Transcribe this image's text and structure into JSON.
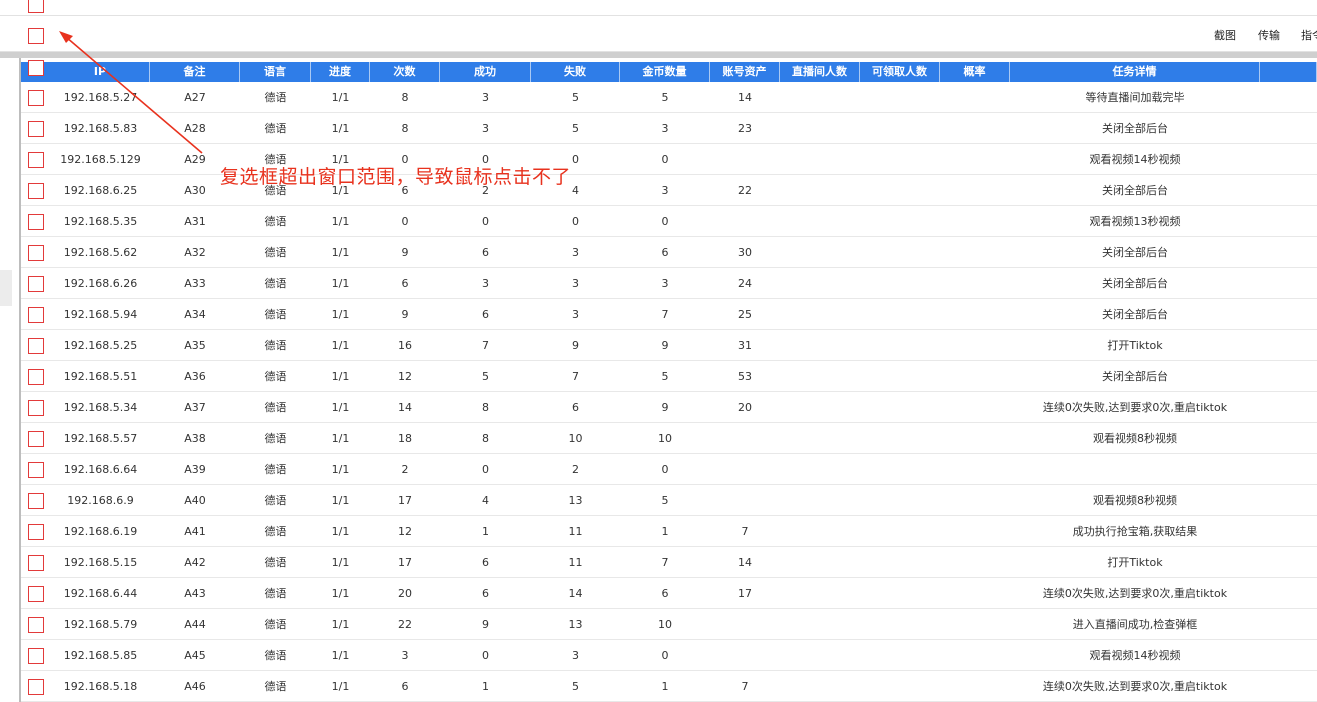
{
  "toolbar": {
    "screenshot_label": "截图",
    "transfer_label": "传输",
    "command_label": "指令"
  },
  "annotation": {
    "text": "复选框超出窗口范围，导致鼠标点击不了"
  },
  "table": {
    "header_color": "#2f7de8",
    "checkbox_color": "#e23a3a",
    "columns": [
      "IP",
      "备注",
      "语言",
      "进度",
      "次数",
      "成功",
      "失败",
      "金币数量",
      "账号资产",
      "直播间人数",
      "可领取人数",
      "概率",
      "任务详情"
    ],
    "rows": [
      {
        "ip": "192.168.5.27",
        "note": "A27",
        "lang": "德语",
        "progress": "1/1",
        "count": "8",
        "success": "3",
        "fail": "5",
        "coins": "5",
        "assets": "14",
        "live": "",
        "claim": "",
        "prob": "",
        "detail": "等待直播间加载完毕"
      },
      {
        "ip": "192.168.5.83",
        "note": "A28",
        "lang": "德语",
        "progress": "1/1",
        "count": "8",
        "success": "3",
        "fail": "5",
        "coins": "3",
        "assets": "23",
        "live": "",
        "claim": "",
        "prob": "",
        "detail": "关闭全部后台"
      },
      {
        "ip": "192.168.5.129",
        "note": "A29",
        "lang": "德语",
        "progress": "1/1",
        "count": "0",
        "success": "0",
        "fail": "0",
        "coins": "0",
        "assets": "",
        "live": "",
        "claim": "",
        "prob": "",
        "detail": "观看视频14秒视频"
      },
      {
        "ip": "192.168.6.25",
        "note": "A30",
        "lang": "德语",
        "progress": "1/1",
        "count": "6",
        "success": "2",
        "fail": "4",
        "coins": "3",
        "assets": "22",
        "live": "",
        "claim": "",
        "prob": "",
        "detail": "关闭全部后台"
      },
      {
        "ip": "192.168.5.35",
        "note": "A31",
        "lang": "德语",
        "progress": "1/1",
        "count": "0",
        "success": "0",
        "fail": "0",
        "coins": "0",
        "assets": "",
        "live": "",
        "claim": "",
        "prob": "",
        "detail": "观看视频13秒视频"
      },
      {
        "ip": "192.168.5.62",
        "note": "A32",
        "lang": "德语",
        "progress": "1/1",
        "count": "9",
        "success": "6",
        "fail": "3",
        "coins": "6",
        "assets": "30",
        "live": "",
        "claim": "",
        "prob": "",
        "detail": "关闭全部后台"
      },
      {
        "ip": "192.168.6.26",
        "note": "A33",
        "lang": "德语",
        "progress": "1/1",
        "count": "6",
        "success": "3",
        "fail": "3",
        "coins": "3",
        "assets": "24",
        "live": "",
        "claim": "",
        "prob": "",
        "detail": "关闭全部后台"
      },
      {
        "ip": "192.168.5.94",
        "note": "A34",
        "lang": "德语",
        "progress": "1/1",
        "count": "9",
        "success": "6",
        "fail": "3",
        "coins": "7",
        "assets": "25",
        "live": "",
        "claim": "",
        "prob": "",
        "detail": "关闭全部后台"
      },
      {
        "ip": "192.168.5.25",
        "note": "A35",
        "lang": "德语",
        "progress": "1/1",
        "count": "16",
        "success": "7",
        "fail": "9",
        "coins": "9",
        "assets": "31",
        "live": "",
        "claim": "",
        "prob": "",
        "detail": "打开Tiktok"
      },
      {
        "ip": "192.168.5.51",
        "note": "A36",
        "lang": "德语",
        "progress": "1/1",
        "count": "12",
        "success": "5",
        "fail": "7",
        "coins": "5",
        "assets": "53",
        "live": "",
        "claim": "",
        "prob": "",
        "detail": "关闭全部后台"
      },
      {
        "ip": "192.168.5.34",
        "note": "A37",
        "lang": "德语",
        "progress": "1/1",
        "count": "14",
        "success": "8",
        "fail": "6",
        "coins": "9",
        "assets": "20",
        "live": "",
        "claim": "",
        "prob": "",
        "detail": "连续0次失败,达到要求0次,重启tiktok"
      },
      {
        "ip": "192.168.5.57",
        "note": "A38",
        "lang": "德语",
        "progress": "1/1",
        "count": "18",
        "success": "8",
        "fail": "10",
        "coins": "10",
        "assets": "",
        "live": "",
        "claim": "",
        "prob": "",
        "detail": "观看视频8秒视频"
      },
      {
        "ip": "192.168.6.64",
        "note": "A39",
        "lang": "德语",
        "progress": "1/1",
        "count": "2",
        "success": "0",
        "fail": "2",
        "coins": "0",
        "assets": "",
        "live": "",
        "claim": "",
        "prob": "",
        "detail": ""
      },
      {
        "ip": "192.168.6.9",
        "note": "A40",
        "lang": "德语",
        "progress": "1/1",
        "count": "17",
        "success": "4",
        "fail": "13",
        "coins": "5",
        "assets": "",
        "live": "",
        "claim": "",
        "prob": "",
        "detail": "观看视频8秒视频"
      },
      {
        "ip": "192.168.6.19",
        "note": "A41",
        "lang": "德语",
        "progress": "1/1",
        "count": "12",
        "success": "1",
        "fail": "11",
        "coins": "1",
        "assets": "7",
        "live": "",
        "claim": "",
        "prob": "",
        "detail": "成功执行抢宝箱,获取结果"
      },
      {
        "ip": "192.168.5.15",
        "note": "A42",
        "lang": "德语",
        "progress": "1/1",
        "count": "17",
        "success": "6",
        "fail": "11",
        "coins": "7",
        "assets": "14",
        "live": "",
        "claim": "",
        "prob": "",
        "detail": "打开Tiktok"
      },
      {
        "ip": "192.168.6.44",
        "note": "A43",
        "lang": "德语",
        "progress": "1/1",
        "count": "20",
        "success": "6",
        "fail": "14",
        "coins": "6",
        "assets": "17",
        "live": "",
        "claim": "",
        "prob": "",
        "detail": "连续0次失败,达到要求0次,重启tiktok"
      },
      {
        "ip": "192.168.5.79",
        "note": "A44",
        "lang": "德语",
        "progress": "1/1",
        "count": "22",
        "success": "9",
        "fail": "13",
        "coins": "10",
        "assets": "",
        "live": "",
        "claim": "",
        "prob": "",
        "detail": "进入直播间成功,检查弹框"
      },
      {
        "ip": "192.168.5.85",
        "note": "A45",
        "lang": "德语",
        "progress": "1/1",
        "count": "3",
        "success": "0",
        "fail": "3",
        "coins": "0",
        "assets": "",
        "live": "",
        "claim": "",
        "prob": "",
        "detail": "观看视频14秒视频"
      },
      {
        "ip": "192.168.5.18",
        "note": "A46",
        "lang": "德语",
        "progress": "1/1",
        "count": "6",
        "success": "1",
        "fail": "5",
        "coins": "1",
        "assets": "7",
        "live": "",
        "claim": "",
        "prob": "",
        "detail": "连续0次失败,达到要求0次,重启tiktok"
      }
    ]
  }
}
